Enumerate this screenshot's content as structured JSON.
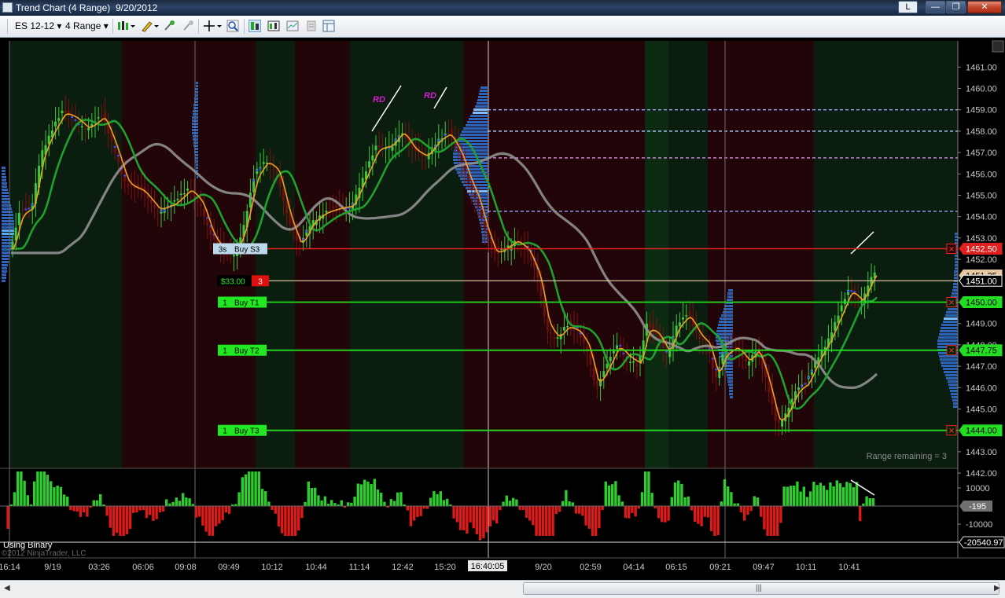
{
  "window": {
    "title": "Trend Chart (4 Range)  9/20/2012",
    "lang_button": "L",
    "min_glyph": "—",
    "max_glyph": "❐",
    "close_glyph": "✕"
  },
  "toolbar": {
    "instrument": "ES 12-12",
    "period": "4 Range",
    "icons": [
      "bar-style-icon",
      "pencil-icon",
      "magnet-icon",
      "pin-icon",
      "crosshair-icon",
      "zoom-icon",
      "data-box-icon",
      "chart-trader-icon",
      "chart-properties-icon",
      "print-icon",
      "layout-icon"
    ]
  },
  "colors": {
    "bg_green_zone": "#0a1d0e",
    "bg_red_zone": "#220508",
    "price_red": "#e02020",
    "target_green": "#22dd22",
    "fast_ma": "#f0a020",
    "mid_ma": "#1fa02f",
    "slow_ma": "#909090",
    "rd_label": "#d020d0"
  },
  "price_axis": {
    "ticks": [
      "1461.00",
      "1460.00",
      "1459.00",
      "1458.00",
      "1457.00",
      "1456.00",
      "1455.00",
      "1454.00",
      "1453.00",
      "1452.00",
      "1451.00",
      "1450.00",
      "1449.00",
      "1448.00",
      "1447.00",
      "1446.00",
      "1445.00",
      "1444.00",
      "1443.00",
      "1442.00"
    ],
    "tags": [
      {
        "text": "1452.50",
        "color": "#e02020"
      },
      {
        "text": "1451.25",
        "color": "#e8c8a0"
      },
      {
        "text": "1451.00",
        "color": "#ffffff"
      },
      {
        "text": "1450.00",
        "color": "#22dd22"
      },
      {
        "text": "1447.75",
        "color": "#22dd22"
      },
      {
        "text": "1444.00",
        "color": "#22dd22"
      }
    ]
  },
  "orders": {
    "stop": {
      "qty": "3s",
      "label": "Buy S3",
      "price": 1452.5
    },
    "pnl": {
      "text": "$33.00",
      "qty": "3"
    },
    "targets": [
      {
        "qty": "1",
        "label": "Buy T1",
        "price": 1450.0
      },
      {
        "qty": "1",
        "label": "Buy T2",
        "price": 1447.75
      },
      {
        "qty": "1",
        "label": "Buy T3",
        "price": 1444.0
      }
    ]
  },
  "annotations": {
    "rd1": "RD",
    "rd2": "RD",
    "range_remaining": "Range remaining = 3",
    "using_binary": "Using Binary",
    "copyright": "©2012 NinjaTrader, LLC"
  },
  "indicator_axis": {
    "ticks": [
      "10000",
      "-10000"
    ],
    "zero_tag": "-195",
    "min_tag": "-20540.97"
  },
  "time_axis": {
    "labels": [
      "16:14",
      "9/19",
      "03:26",
      "06:06",
      "09:08",
      "09:49",
      "10:12",
      "10:44",
      "11:14",
      "12:42",
      "15:20",
      "16:40:05",
      "9/20",
      "02:59",
      "04:14",
      "06:15",
      "09:21",
      "09:47",
      "10:11",
      "10:41"
    ],
    "cursor_label": "16:40:05"
  },
  "scrollbar": {
    "left": "◀",
    "right": "▶",
    "grip": "|||"
  }
}
